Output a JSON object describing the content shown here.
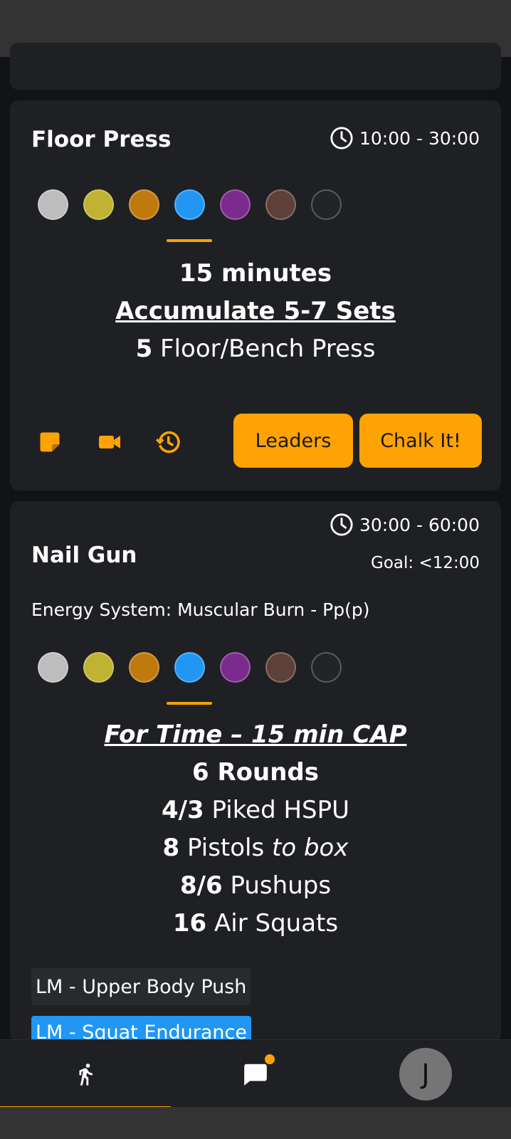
{
  "colors": {
    "accent": "#ffa305",
    "card": "#1f2023",
    "dots": [
      "#bdbdbd",
      "#c0b232",
      "#c0790c",
      "#2196f3",
      "#7b2a8e",
      "#5d4037",
      "#222426"
    ]
  },
  "cards": [
    {
      "title": "Floor Press",
      "time": "10:00 - 30:00",
      "workout": {
        "line1": "15 minutes",
        "line2": "Accumulate 5-7 Sets",
        "line3_num": "5",
        "line3_text": " Floor/Bench Press"
      },
      "actions": {
        "icons": [
          "note-icon",
          "video-icon",
          "history-icon"
        ],
        "leaders_label": "Leaders",
        "chalk_label": "Chalk It!"
      }
    },
    {
      "title": "Nail Gun",
      "time": "30:00 - 60:00",
      "goal": "Goal: <12:00",
      "energy": "Energy System: Muscular Burn - Pp(p)",
      "workout": {
        "header": "For Time – 15 min CAP",
        "rounds": "6 Rounds",
        "l1_num": "4/3",
        "l1_text": " Piked HSPU",
        "l2_num": "8",
        "l2_text": " Pistols ",
        "l2_italic": "to box",
        "l3_num": "8/6",
        "l3_text": " Pushups",
        "l4_num": "16",
        "l4_text": " Air Squats"
      },
      "tags": [
        "LM - Upper Body Push",
        "LM - Squat Endurance"
      ]
    }
  ],
  "bottom_nav": {
    "items": [
      "workout-icon",
      "chat-icon",
      "avatar"
    ],
    "avatar_initial": "J"
  }
}
